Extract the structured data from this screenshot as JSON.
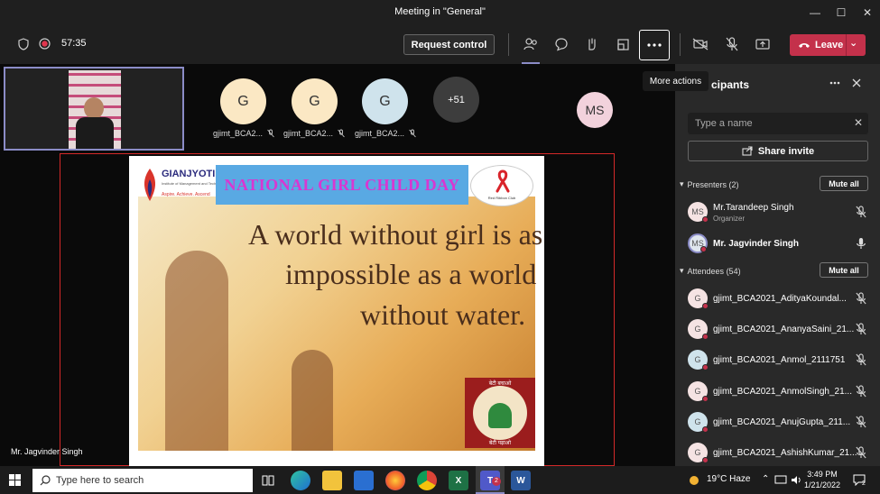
{
  "window": {
    "title": "Meeting in \"General\"",
    "minimize": "—",
    "maximize": "☐",
    "close": "✕"
  },
  "toolbar": {
    "timer": "57:35",
    "request_control": "Request control",
    "leave": "Leave"
  },
  "tooltip": "More actions",
  "stage": {
    "participants": [
      {
        "initial": "G",
        "name": "gjimt_BCA2..."
      },
      {
        "initial": "G",
        "name": "gjimt_BCA2..."
      },
      {
        "initial": "G",
        "name": "gjimt_BCA2..."
      }
    ],
    "overflow": "+51",
    "ms_initials": "MS",
    "presenter_name": "Mr. Jagvinder Singh"
  },
  "slide": {
    "brand": "GIANJYOTI",
    "brand_sub": "Institute of Management and Technology",
    "motto": "Aspire. Achieve. Ascend",
    "banner": "NATIONAL GIRL CHILD DAY",
    "ribbon_label": "Red Ribbon Club",
    "quote_lines": [
      "A world without girl is as",
      "impossible as a world",
      "without water."
    ],
    "badge_top": "बेटी बचाओ",
    "badge_bottom": "बेटी पढ़ाओ"
  },
  "panel": {
    "title": "cipants",
    "search_placeholder": "Type a name",
    "share_invite": "Share invite",
    "presenters_header": "Presenters (2)",
    "attendees_header": "Attendees (54)",
    "mute_all": "Mute all",
    "presenters": [
      {
        "initials": "MS",
        "name": "Mr.Tarandeep Singh",
        "role": "Organizer"
      },
      {
        "initials": "MS",
        "name": "Mr. Jagvinder Singh",
        "role": ""
      }
    ],
    "attendees": [
      {
        "initials": "G",
        "name": "gjimt_BCA2021_AdityaKoundal..."
      },
      {
        "initials": "G",
        "name": "gjimt_BCA2021_AnanyaSaini_21..."
      },
      {
        "initials": "G",
        "name": "gjimt_BCA2021_Anmol_2111751"
      },
      {
        "initials": "G",
        "name": "gjimt_BCA2021_AnmolSingh_21..."
      },
      {
        "initials": "G",
        "name": "gjimt_BCA2021_AnujGupta_211..."
      },
      {
        "initials": "G",
        "name": "gjimt_BCA2021_AshishKumar_21..."
      }
    ]
  },
  "taskbar": {
    "search_placeholder": "Type here to search",
    "weather": "19°C  Haze",
    "time": "3:49 PM",
    "date": "1/21/2022",
    "notification_count": "2",
    "teams_badge": "2"
  },
  "colors": {
    "leave": "#c4314b",
    "accent": "#8b8cc7",
    "share_border": "#d42929"
  }
}
